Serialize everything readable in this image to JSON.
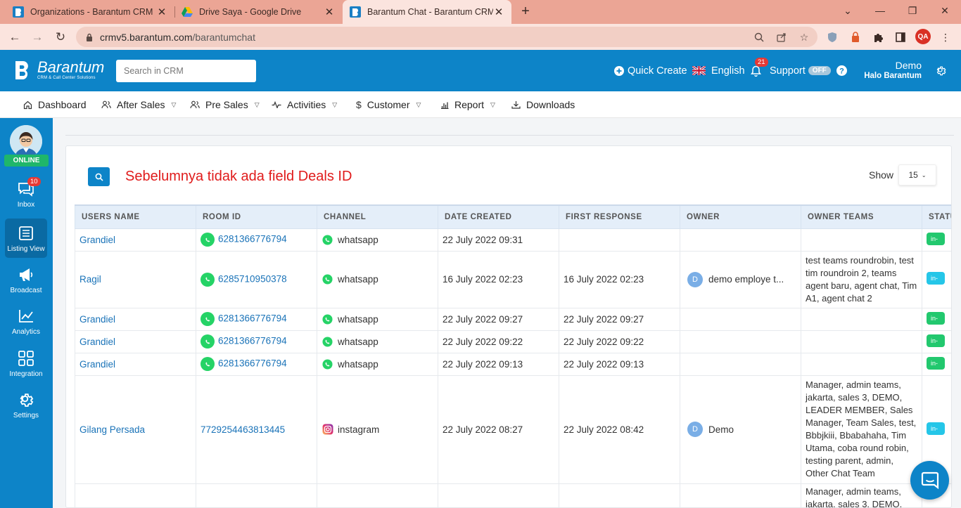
{
  "browser": {
    "tabs": [
      {
        "title": "Organizations - Barantum CRM",
        "active": false
      },
      {
        "title": "Drive Saya - Google Drive",
        "active": false
      },
      {
        "title": "Barantum Chat - Barantum CRM",
        "active": true
      }
    ],
    "url_host": "crmv5.barantum.com",
    "url_path": "/barantumchat",
    "profile_initials": "QA"
  },
  "header": {
    "logo_name": "Barantum",
    "logo_tagline": "CRM & Call Center Solutions",
    "search_placeholder": "Search in CRM",
    "quick_create": "Quick Create",
    "language": "English",
    "notif_count": "21",
    "support_label": "Support",
    "support_state": "OFF",
    "user_name": "Demo",
    "user_greeting": "Halo Barantum"
  },
  "menu": {
    "items": [
      {
        "label": "Dashboard",
        "icon": "home-icon",
        "dropdown": false
      },
      {
        "label": "After Sales",
        "icon": "users-icon",
        "dropdown": true
      },
      {
        "label": "Pre Sales",
        "icon": "users-icon",
        "dropdown": true
      },
      {
        "label": "Activities",
        "icon": "activity-icon",
        "dropdown": true
      },
      {
        "label": "Customer",
        "icon": "dollar-icon",
        "dropdown": true
      },
      {
        "label": "Report",
        "icon": "bar-chart-icon",
        "dropdown": true
      },
      {
        "label": "Downloads",
        "icon": "download-icon",
        "dropdown": false
      }
    ]
  },
  "sidebar": {
    "status": "ONLINE",
    "inbox_count": "10",
    "items": [
      {
        "label": "Inbox",
        "icon": "chat-icon",
        "active": false
      },
      {
        "label": "Listing View",
        "icon": "list-icon",
        "active": true
      },
      {
        "label": "Broadcast",
        "icon": "megaphone-icon",
        "active": false
      },
      {
        "label": "Analytics",
        "icon": "line-chart-icon",
        "active": false
      },
      {
        "label": "Integration",
        "icon": "grid-icon",
        "active": false
      },
      {
        "label": "Settings",
        "icon": "gear-icon",
        "active": false
      }
    ]
  },
  "main": {
    "notice": "Sebelumnya tidak ada field Deals ID",
    "show_label": "Show",
    "show_value": "15",
    "columns": [
      "USERS NAME",
      "ROOM ID",
      "CHANNEL",
      "DATE CREATED",
      "FIRST RESPONSE",
      "OWNER",
      "OWNER TEAMS",
      "STATUS"
    ],
    "rows": [
      {
        "user": "Grandiel",
        "room": "6281366776794",
        "channel": "whatsapp",
        "created": "22 July 2022 09:31",
        "first_response": "",
        "owner": "",
        "owner_initial": "",
        "teams": "",
        "status": "in-"
      },
      {
        "user": "Ragil",
        "room": "6285710950378",
        "channel": "whatsapp",
        "created": "16 July 2022 02:23",
        "first_response": "16 July 2022 02:23",
        "owner": "demo employe t...",
        "owner_initial": "D",
        "teams": "test teams roundrobin, test tim roundroin 2, teams agent baru, agent chat, Tim A1, agent chat 2",
        "status": "in-"
      },
      {
        "user": "Grandiel",
        "room": "6281366776794",
        "channel": "whatsapp",
        "created": "22 July 2022 09:27",
        "first_response": "22 July 2022 09:27",
        "owner": "",
        "owner_initial": "",
        "teams": "",
        "status": "in-"
      },
      {
        "user": "Grandiel",
        "room": "6281366776794",
        "channel": "whatsapp",
        "created": "22 July 2022 09:22",
        "first_response": "22 July 2022 09:22",
        "owner": "",
        "owner_initial": "",
        "teams": "",
        "status": "in-"
      },
      {
        "user": "Grandiel",
        "room": "6281366776794",
        "channel": "whatsapp",
        "created": "22 July 2022 09:13",
        "first_response": "22 July 2022 09:13",
        "owner": "",
        "owner_initial": "",
        "teams": "",
        "status": "in-"
      },
      {
        "user": "Gilang Persada",
        "room": "7729254463813445",
        "channel": "instagram",
        "created": "22 July 2022 08:27",
        "first_response": "22 July 2022 08:42",
        "owner": "Demo",
        "owner_initial": "D",
        "teams": "Manager, admin teams, jakarta, sales 3, DEMO, LEADER MEMBER, Sales Manager, Team Sales, test, Bbbjkiii, Bbabahaha, Tim Utama, coba round robin, testing parent, admin, Other Chat Team",
        "status": "in-"
      },
      {
        "user": "",
        "room": "",
        "channel": "",
        "created": "",
        "first_response": "",
        "owner": "",
        "owner_initial": "",
        "teams": "Manager, admin teams, jakarta, sales 3, DEMO,",
        "status": ""
      }
    ]
  },
  "colors": {
    "brand_blue": "#0d84c8",
    "notice_red": "#e01b1b",
    "online_green": "#1fb66a",
    "tab_bar": "#eba595"
  }
}
